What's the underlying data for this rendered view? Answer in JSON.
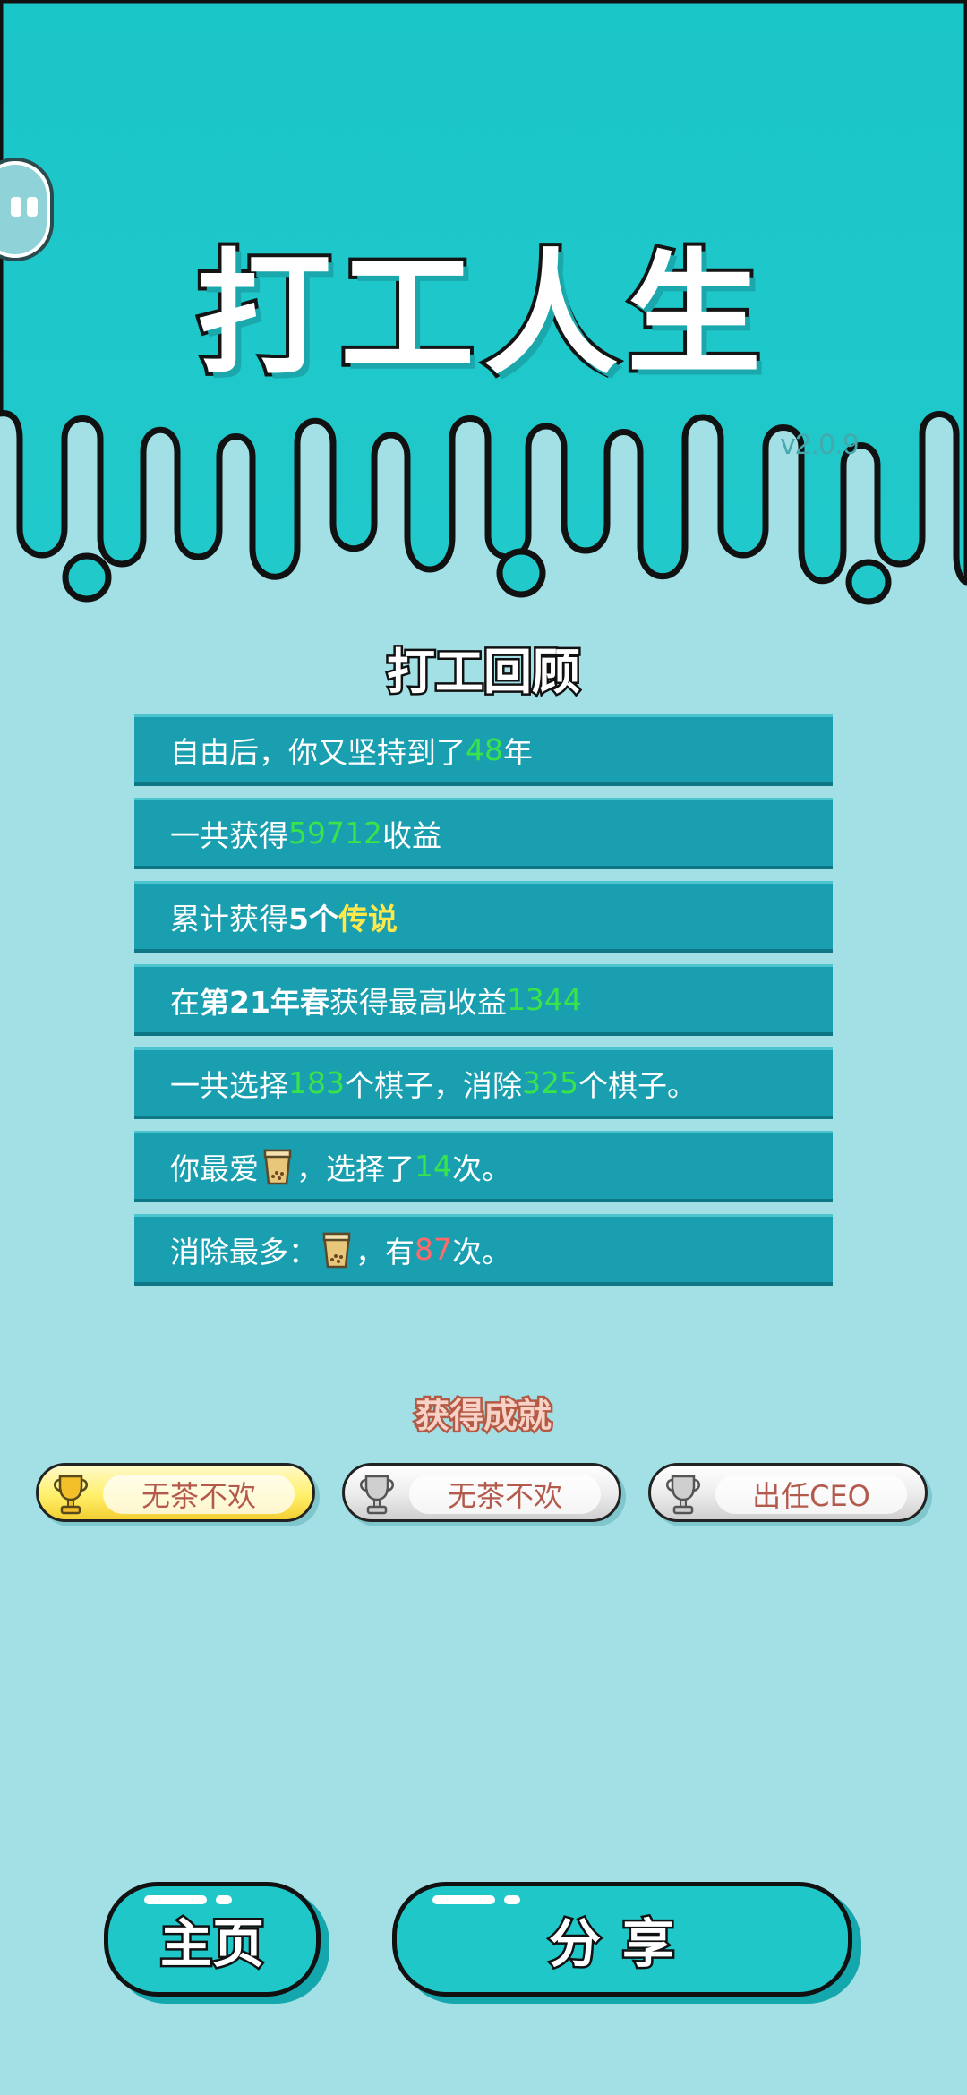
{
  "header": {
    "title": "打工人生",
    "version": "v2.0.9"
  },
  "review": {
    "title": "打工回顾",
    "rows": [
      {
        "pre": "自由后，你又坚持到了",
        "num": "48",
        "post": "年"
      },
      {
        "pre": "一共获得",
        "num": "59712",
        "post": "收益"
      },
      {
        "pre": "累计获得",
        "bold": "5个",
        "highlight": "传说"
      },
      {
        "pre": "在 ",
        "bold": "第21年春",
        "mid": " 获得最高收益",
        "num": "1344"
      },
      {
        "pre": "一共选择",
        "num": "183",
        "mid": "个棋子，消除",
        "num2": "325",
        "post": "个棋子。"
      },
      {
        "pre": "你最爱",
        "icon": "milk-tea-cup-icon",
        "mid": "，选择了",
        "num": "14",
        "post": "次。"
      },
      {
        "pre": "消除最多：",
        "icon": "milk-tea-cup-icon",
        "mid": "，有",
        "num": "87",
        "post": "次。"
      }
    ]
  },
  "achievements": {
    "title": "获得成就",
    "items": [
      {
        "label": "无茶不欢",
        "tier": "gold",
        "icon": "trophy-icon"
      },
      {
        "label": "无茶不欢",
        "tier": "silver",
        "icon": "trophy-icon"
      },
      {
        "label": "出任CEO",
        "tier": "silver",
        "icon": "trophy-icon"
      }
    ]
  },
  "buttons": {
    "home": "主页",
    "share": "分享"
  },
  "colors": {
    "header": "#19c6c8",
    "background": "#a2e0e6",
    "row": "#1a9fb0",
    "number_green": "#39e34a",
    "highlight_yellow": "#ffe94a",
    "number_red": "#ff6b6b"
  }
}
